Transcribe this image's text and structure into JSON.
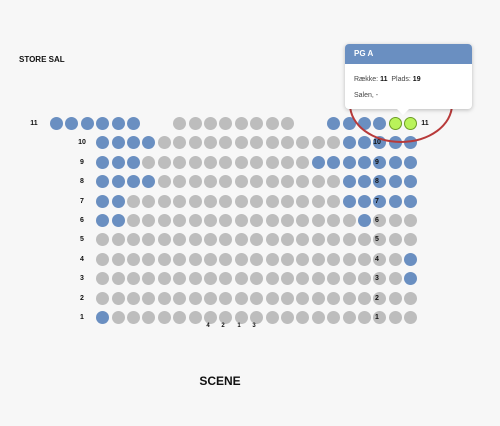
{
  "hall_title": "STORE SAL",
  "scene_label": "SCENE",
  "tooltip": {
    "title": "PG A",
    "row_label": "Række:",
    "row_value": "11",
    "seat_label": "Plads:",
    "seat_value": "19",
    "area_text": "Salen, -"
  },
  "column_labels": [
    "4",
    "2",
    "1",
    "3"
  ],
  "colors": {
    "available": "#bdbdbd",
    "taken": "#6a8fc1",
    "selected": "#b9f35a",
    "highlight": "#b83a3a"
  },
  "rows": [
    {
      "label": "11",
      "seats": [
        "T",
        "T",
        "T",
        "T",
        "T",
        "T",
        "_",
        "_",
        "A",
        "A",
        "A",
        "A",
        "A",
        "A",
        "A",
        "A",
        "_",
        "_",
        "T",
        "T",
        "T",
        "T",
        "S",
        "S"
      ]
    },
    {
      "label": "10",
      "seats": [
        "_",
        "_",
        "_",
        "T",
        "T",
        "T",
        "T",
        "A",
        "A",
        "A",
        "A",
        "A",
        "A",
        "A",
        "A",
        "A",
        "A",
        "A",
        "A",
        "T",
        "T",
        "T",
        "T",
        "T",
        "_"
      ]
    },
    {
      "label": "9",
      "seats": [
        "_",
        "_",
        "_",
        "T",
        "T",
        "T",
        "A",
        "A",
        "A",
        "A",
        "A",
        "A",
        "A",
        "A",
        "A",
        "A",
        "A",
        "T",
        "T",
        "T",
        "T",
        "T",
        "T",
        "T",
        "_"
      ]
    },
    {
      "label": "8",
      "seats": [
        "_",
        "_",
        "_",
        "T",
        "T",
        "T",
        "T",
        "A",
        "A",
        "A",
        "A",
        "A",
        "A",
        "A",
        "A",
        "A",
        "A",
        "A",
        "A",
        "T",
        "T",
        "T",
        "T",
        "T",
        "_"
      ]
    },
    {
      "label": "7",
      "seats": [
        "_",
        "_",
        "_",
        "T",
        "T",
        "A",
        "A",
        "A",
        "A",
        "A",
        "A",
        "A",
        "A",
        "A",
        "A",
        "A",
        "A",
        "A",
        "A",
        "T",
        "T",
        "T",
        "T",
        "T",
        "_"
      ]
    },
    {
      "label": "6",
      "seats": [
        "_",
        "_",
        "_",
        "T",
        "T",
        "A",
        "A",
        "A",
        "A",
        "A",
        "A",
        "A",
        "A",
        "A",
        "A",
        "A",
        "A",
        "A",
        "A",
        "A",
        "T",
        "A",
        "A",
        "A",
        "_"
      ]
    },
    {
      "label": "5",
      "seats": [
        "_",
        "_",
        "_",
        "A",
        "A",
        "A",
        "A",
        "A",
        "A",
        "A",
        "A",
        "A",
        "A",
        "A",
        "A",
        "A",
        "A",
        "A",
        "A",
        "A",
        "A",
        "A",
        "A",
        "A",
        "_"
      ]
    },
    {
      "label": "4",
      "seats": [
        "_",
        "_",
        "_",
        "A",
        "A",
        "A",
        "A",
        "A",
        "A",
        "A",
        "A",
        "A",
        "A",
        "A",
        "A",
        "A",
        "A",
        "A",
        "A",
        "A",
        "A",
        "A",
        "A",
        "T",
        "_"
      ]
    },
    {
      "label": "3",
      "seats": [
        "_",
        "_",
        "_",
        "A",
        "A",
        "A",
        "A",
        "A",
        "A",
        "A",
        "A",
        "A",
        "A",
        "A",
        "A",
        "A",
        "A",
        "A",
        "A",
        "A",
        "A",
        "A",
        "A",
        "T",
        "_"
      ]
    },
    {
      "label": "2",
      "seats": [
        "_",
        "_",
        "_",
        "A",
        "A",
        "A",
        "A",
        "A",
        "A",
        "A",
        "A",
        "A",
        "A",
        "A",
        "A",
        "A",
        "A",
        "A",
        "A",
        "A",
        "A",
        "A",
        "A",
        "A",
        "_"
      ]
    },
    {
      "label": "1",
      "seats": [
        "_",
        "_",
        "_",
        "T",
        "A",
        "A",
        "A",
        "A",
        "A",
        "A",
        "A",
        "A",
        "A",
        "A",
        "A",
        "A",
        "A",
        "A",
        "A",
        "A",
        "A",
        "A",
        "A",
        "A",
        "_"
      ]
    }
  ]
}
